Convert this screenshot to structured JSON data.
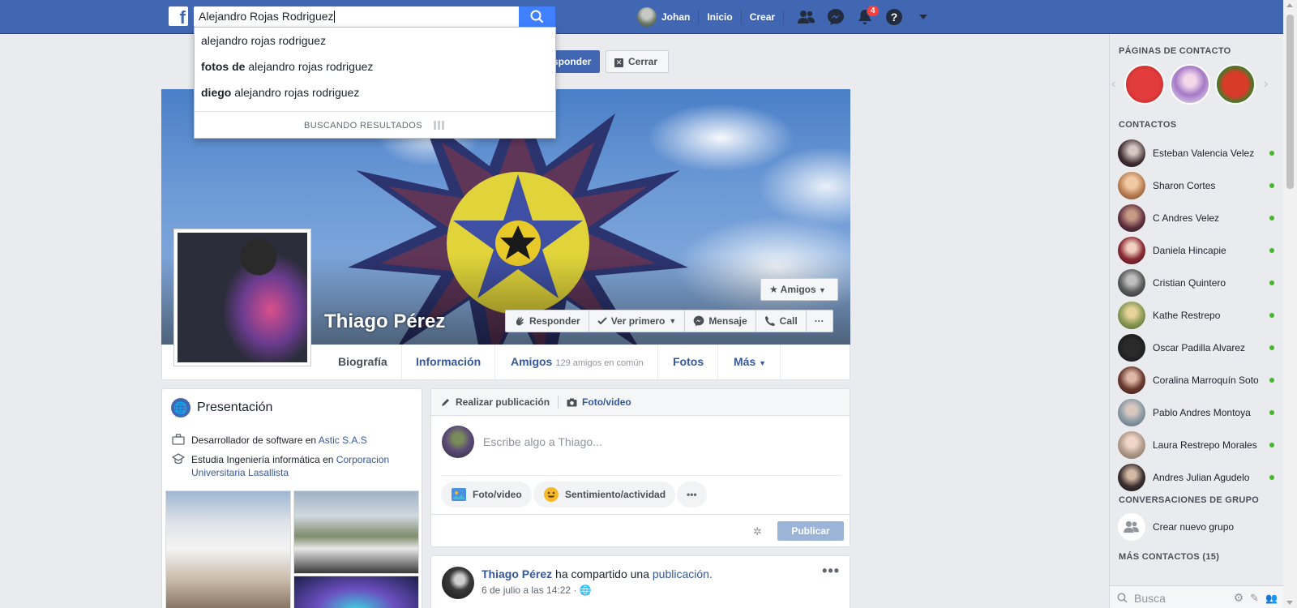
{
  "topbar": {
    "search_value": "Alejandro Rojas Rodriguez",
    "user_name": "Johan",
    "home_label": "Inicio",
    "create_label": "Crear",
    "notification_count": "4"
  },
  "search_dropdown": {
    "items": [
      {
        "bold": "",
        "text": "alejandro rojas rodriguez"
      },
      {
        "bold": "fotos de",
        "text": "alejandro rojas rodriguez"
      },
      {
        "bold": "diego",
        "text": "alejandro rojas rodriguez"
      }
    ],
    "footer": "BUSCANDO RESULTADOS"
  },
  "friend_request": {
    "respond_label": "sponder",
    "close_label": "Cerrar"
  },
  "profile": {
    "name": "Thiago Pérez",
    "amigos_label": "Amigos",
    "actions": [
      "Responder",
      "Ver primero",
      "Mensaje",
      "Call",
      "···"
    ]
  },
  "tabs": [
    {
      "label": "Biografía",
      "extra": ""
    },
    {
      "label": "Información",
      "extra": ""
    },
    {
      "label": "Amigos",
      "extra": "129 amigos en común"
    },
    {
      "label": "Fotos",
      "extra": ""
    },
    {
      "label": "Más",
      "extra": ""
    }
  ],
  "intro": {
    "title": "Presentación",
    "work_prefix": "Desarrollador de software en",
    "work_link": "Astic S.A.S",
    "study_prefix": "Estudia Ingeniería informática en",
    "study_link": "Corporacion Universitaria Lasallista"
  },
  "composer": {
    "tab_post": "Realizar publicación",
    "tab_photo": "Foto/video",
    "placeholder": "Escribe algo a Thiago...",
    "pill_photo": "Foto/video",
    "pill_feeling": "Sentimiento/actividad",
    "pill_more": "•••",
    "publish_label": "Publicar"
  },
  "post": {
    "author": "Thiago Pérez",
    "verb": "ha compartido una",
    "object": "publicación.",
    "date": "6 de julio a las 14:22 ·",
    "more": "•••"
  },
  "sidebar": {
    "pages_header": "PÁGINAS DE CONTACTO",
    "contacts_header": "CONTACTOS",
    "contacts": [
      "Esteban Valencia Velez",
      "Sharon Cortes",
      "C Andres Velez",
      "Daniela Hincapie",
      "Cristian Quintero",
      "Kathe Restrepo",
      "Oscar Padilla Alvarez",
      "Coralina Marroquín Soto",
      "Pablo Andres Montoya",
      "Laura Restrepo Morales",
      "Andres Julian Agudelo"
    ],
    "groups_header": "CONVERSACIONES DE GRUPO",
    "new_group_label": "Crear nuevo grupo",
    "more_contacts": "MÁS CONTACTOS (15)",
    "search_placeholder": "Busca"
  },
  "colors": {
    "brand_blue": "#4267b2",
    "link_blue": "#365899",
    "online_green": "#42b72a",
    "badge_red": "#fa3e3e"
  }
}
